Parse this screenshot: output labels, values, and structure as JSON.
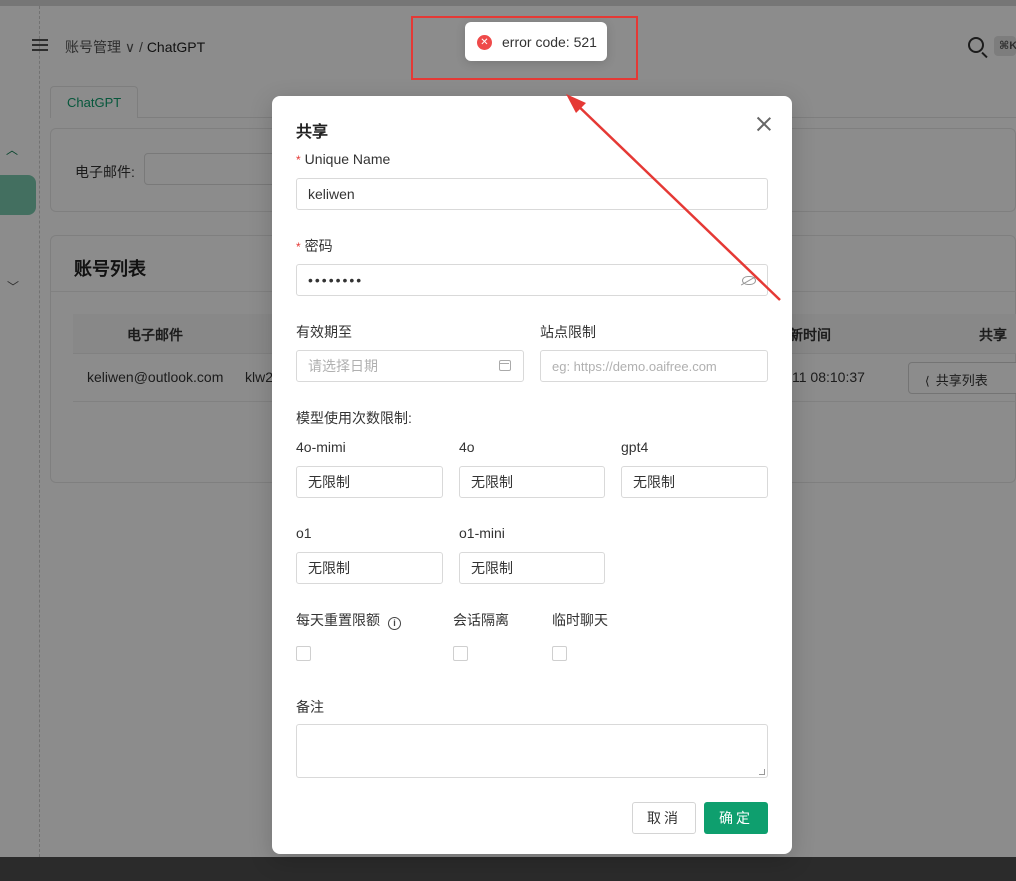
{
  "colors": {
    "accent": "#0e9f6e",
    "error": "#ef4a4a",
    "annotation": "#e53935"
  },
  "header": {
    "breadcrumb_parent": "账号管理 ∨",
    "breadcrumb_sep": "/",
    "breadcrumb_current": "ChatGPT",
    "kbd_hint": "⌘K"
  },
  "tabs": [
    {
      "label": "ChatGPT"
    }
  ],
  "search": {
    "email_label": "电子邮件:"
  },
  "account_list": {
    "title": "账号列表",
    "columns": [
      "电子邮件",
      "新时间",
      "共享"
    ],
    "rows": [
      {
        "email": "keliwen@outlook.com",
        "name_partial": "klw2",
        "time_partial": "11 08:10:37",
        "share_label": "共享列表"
      }
    ]
  },
  "toast": {
    "icon": "error-icon",
    "message": "error code: 521"
  },
  "dialog": {
    "title": "共享",
    "unique_name": {
      "label": "Unique Name",
      "value": "keliwen",
      "required": true
    },
    "password": {
      "label": "密码",
      "value": "••••••••",
      "required": true
    },
    "expiry": {
      "label": "有效期至",
      "placeholder": "请选择日期"
    },
    "site_limit": {
      "label": "站点限制",
      "placeholder": "eg: https://demo.oaifree.com"
    },
    "model_limits_label": "模型使用次数限制:",
    "models": [
      {
        "label": "4o-mimi",
        "value": "无限制"
      },
      {
        "label": "4o",
        "value": "无限制"
      },
      {
        "label": "gpt4",
        "value": "无限制"
      },
      {
        "label": "o1",
        "value": "无限制"
      },
      {
        "label": "o1-mini",
        "value": "无限制"
      }
    ],
    "checkboxes": [
      {
        "label": "每天重置限额",
        "checked": false
      },
      {
        "label": "会话隔离",
        "checked": false
      },
      {
        "label": "临时聊天",
        "checked": false
      }
    ],
    "remark_label": "备注",
    "cancel_label": "取消",
    "ok_label": "确定"
  }
}
